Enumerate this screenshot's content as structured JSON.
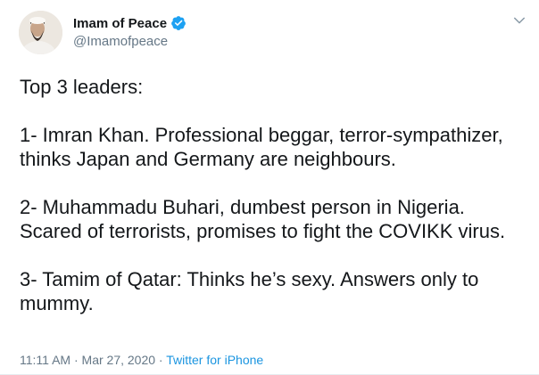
{
  "author": {
    "display_name": "Imam of Peace",
    "handle": "@Imamofpeace",
    "verified": true
  },
  "tweet": {
    "lines": [
      "Top 3 leaders:",
      "",
      "1- Imran Khan. Professional beggar, terror-sympathizer,",
      "thinks Japan and Germany are neighbours.",
      "",
      "2- Muhammadu Buhari, dumbest person in Nigeria.",
      "Scared of terrorists, promises to fight the COVIKK virus.",
      "",
      "3- Tamim of Qatar: Thinks he’s sexy. Answers only to",
      "mummy."
    ]
  },
  "meta": {
    "time": "11:11 AM",
    "separator1": " · ",
    "date": "Mar 27, 2020",
    "separator2": " · ",
    "source": "Twitter for iPhone"
  },
  "icons": {
    "verified": "verified-badge-icon",
    "caret": "chevron-down-icon"
  },
  "colors": {
    "accent": "#1da1f2",
    "link": "#1b95e0",
    "secondary_text": "#657786",
    "primary_text": "#14171a"
  }
}
